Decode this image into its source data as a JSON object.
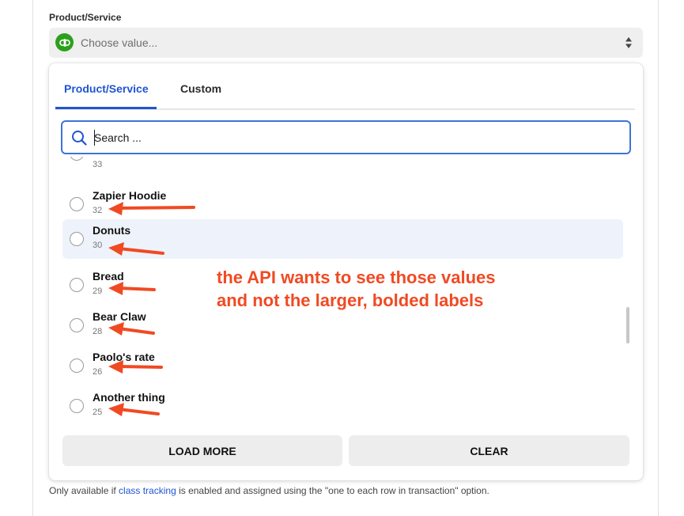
{
  "field": {
    "label": "Product/Service",
    "placeholder": "Choose value..."
  },
  "tabs": [
    {
      "label": "Product/Service",
      "active": true
    },
    {
      "label": "Custom",
      "active": false
    }
  ],
  "search": {
    "value": "Search ..."
  },
  "items": [
    {
      "label": "",
      "value": "33"
    },
    {
      "label": "Zapier Hoodie",
      "value": "32"
    },
    {
      "label": "Donuts",
      "value": "30",
      "highlighted": true
    },
    {
      "label": "Bread",
      "value": "29"
    },
    {
      "label": "Bear Claw",
      "value": "28"
    },
    {
      "label": "Paolo's rate",
      "value": "26"
    },
    {
      "label": "Another thing",
      "value": "25"
    }
  ],
  "buttons": {
    "load_more": "LOAD MORE",
    "clear": "CLEAR"
  },
  "help": {
    "before": "Only available if ",
    "link": "class tracking",
    "after": " is enabled and assigned using the \"one to each row in transaction\" option."
  },
  "annotation": {
    "line1": "the API wants to see those values",
    "line2": "and not the larger, bolded labels"
  },
  "colors": {
    "accent": "#1f54d3",
    "annotation": "#f04a23",
    "app_icon": "#2ca01c"
  },
  "icons": {
    "app": "quickbooks-icon",
    "select": "sort-updown-icon",
    "search": "search-icon"
  }
}
